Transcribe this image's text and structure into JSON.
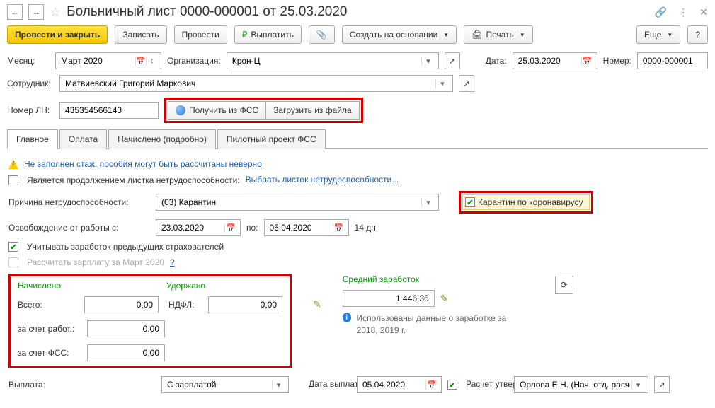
{
  "title": "Больничный лист 0000-000001 от 25.03.2020",
  "toolbar": {
    "post_close": "Провести и закрыть",
    "write": "Записать",
    "post": "Провести",
    "pay": "Выплатить",
    "create_based": "Создать на основании",
    "print": "Печать",
    "more": "Еще",
    "help": "?"
  },
  "header": {
    "month_lbl": "Месяц:",
    "month_val": "Март 2020",
    "org_lbl": "Организация:",
    "org_val": "Крон-Ц",
    "date_lbl": "Дата:",
    "date_val": "25.03.2020",
    "num_lbl": "Номер:",
    "num_val": "0000-000001",
    "emp_lbl": "Сотрудник:",
    "emp_val": "Матвиевский Григорий Маркович",
    "ln_lbl": "Номер ЛН:",
    "ln_val": "435354566143",
    "get_fss": "Получить из ФСС",
    "load_file": "Загрузить из файла"
  },
  "tabs": {
    "main": "Главное",
    "pay": "Оплата",
    "accrued": "Начислено (подробно)",
    "pilot": "Пилотный проект ФСС"
  },
  "main": {
    "warn": "Не заполнен стаж, пособия могут быть рассчитаны неверно",
    "is_continuation": "Является продолжением листка нетрудоспособности:",
    "choose_sheet": "Выбрать листок нетрудоспособности...",
    "reason_lbl": "Причина нетрудоспособности:",
    "reason_val": "(03) Карантин",
    "covid": "Карантин по коронавирусу",
    "release_lbl": "Освобождение от работы с:",
    "release_from": "23.03.2020",
    "to_lbl": "по:",
    "release_to": "05.04.2020",
    "days": "14 дн.",
    "prev_ins": "Учитывать заработок предыдущих страхователей",
    "calc_salary": "Рассчитать зарплату за Март 2020",
    "help_q": "?"
  },
  "totals": {
    "accrued": "Начислено",
    "withheld": "Удержано",
    "total_lbl": "Всего:",
    "total_val": "0,00",
    "ndfl_lbl": "НДФЛ:",
    "ndfl_val": "0,00",
    "employer_lbl": "за счет работ.:",
    "employer_val": "0,00",
    "fss_lbl": "за счет ФСС:",
    "fss_val": "0,00",
    "avg_lbl": "Средний заработок",
    "avg_val": "1 446,36",
    "info": "Использованы данные о заработке за 2018,   2019 г."
  },
  "footer": {
    "payout_lbl": "Выплата:",
    "payout_val": "С зарплатой",
    "paydate_lbl": "Дата выплаты:",
    "paydate_val": "05.04.2020",
    "approved": "Расчет утвердил",
    "approver": "Орлова Е.Н. (Нач. отд. расчет"
  }
}
